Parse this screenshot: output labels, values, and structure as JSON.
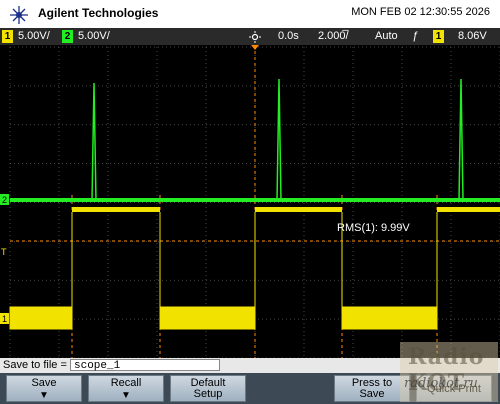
{
  "header": {
    "brand": "Agilent Technologies",
    "datetime": "MON FEB 02 12:30:55 2026"
  },
  "status": {
    "ch1_num": "1",
    "ch1_scale": "5.00V/",
    "ch2_num": "2",
    "ch2_scale": "5.00V/",
    "delay": "0.0s",
    "timebase": "2.000̅/",
    "mode": "Auto",
    "trig_slope": "ƒ",
    "trig_ch": "1",
    "trig_level": "8.06V"
  },
  "plot": {
    "ch2_marker": "2",
    "ch1_marker": "1",
    "trig_marker": "T",
    "measurement": "RMS(1): 9.99V"
  },
  "save": {
    "label": "Save to file =",
    "filename": "scope_1"
  },
  "softkeys": {
    "save": "Save",
    "recall": "Recall",
    "default_line1": "Default",
    "default_line2": "Setup",
    "press_line1": "Press to",
    "press_line2": "Save",
    "quick_print": "Quick Print"
  },
  "watermark": {
    "line1": "Radio KOT",
    "line2": "radiokot.ru"
  },
  "colors": {
    "ch1": "#f2e200",
    "ch2": "#22ee22",
    "grid": "#5a5a5a",
    "trigger": "#ff8a00"
  }
}
